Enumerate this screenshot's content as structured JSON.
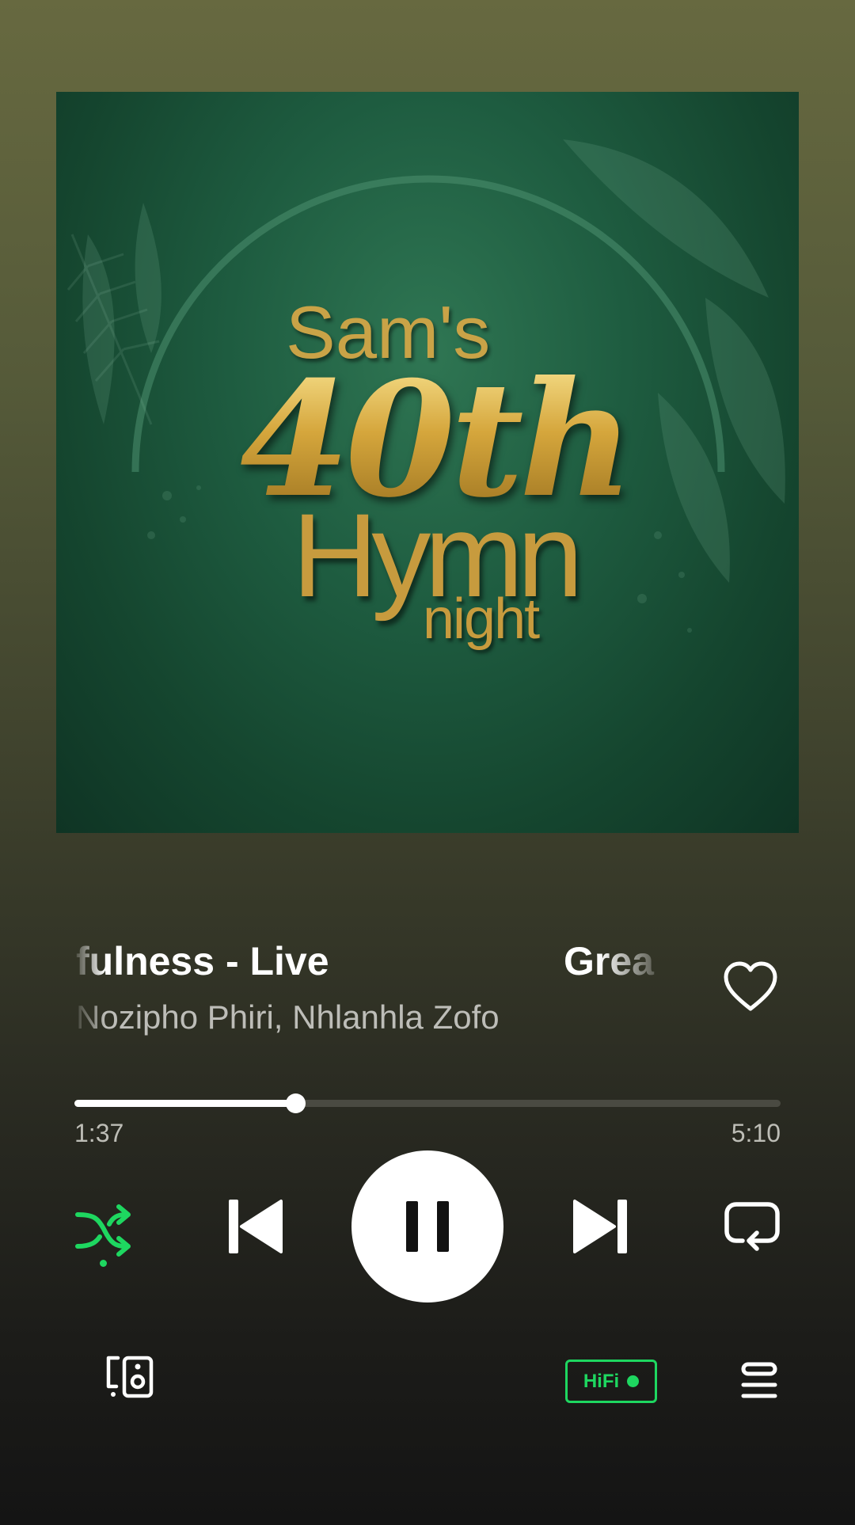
{
  "album_art": {
    "line1": "Sam's",
    "line2": "40th",
    "line3": "Hymn",
    "line4": "night"
  },
  "track": {
    "title_tail": "fulness - Live",
    "title_next_start": "Grea",
    "artists": "Nozipho Phiri, Nhlanhla Zofo"
  },
  "progress": {
    "elapsed": "1:37",
    "duration": "5:10",
    "fraction": 0.313
  },
  "controls": {
    "shuffle_state": "on",
    "play_state": "playing",
    "repeat_state": "off"
  },
  "bottom": {
    "hifi_label": "HiFi"
  },
  "colors": {
    "accent": "#1ed760",
    "background_top": "#676940",
    "background_bottom": "#141414"
  }
}
